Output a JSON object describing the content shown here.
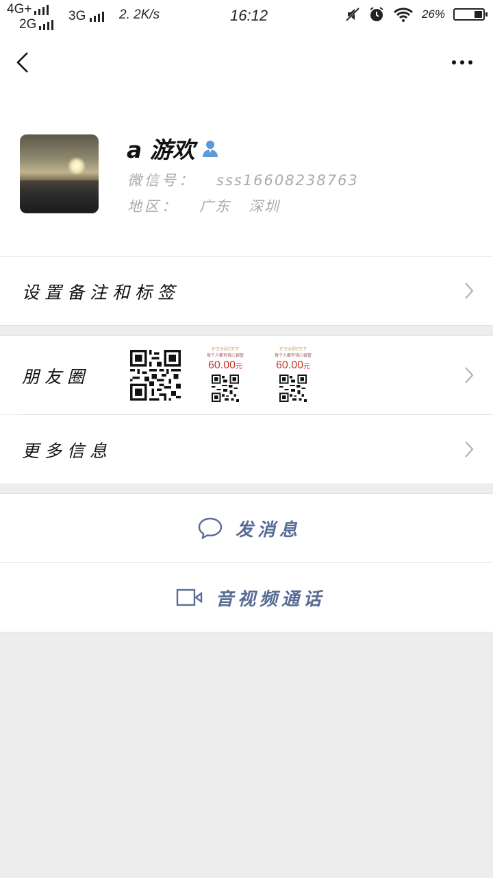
{
  "status_bar": {
    "net1": "4G+",
    "net2": "2G",
    "net3": "3G",
    "speed": "2. 2K/s",
    "time": "16:12",
    "battery": "26%",
    "battery_level": 0.26
  },
  "profile": {
    "nickname": "a 游欢",
    "wechat_id_label": "微信号：",
    "wechat_id": "sss16608238763",
    "region_label": "地区：",
    "region": "广东   深圳"
  },
  "cells": {
    "remark_label": "设置备注和标签",
    "moments_label": "朋友圈",
    "more_info_label": "更多信息"
  },
  "moments_promos": [
    {
      "price": "60.00",
      "unit": "元",
      "head": "护卫全程Z灭下",
      "sub": "每个人都有钱心银管"
    },
    {
      "price": "60.00",
      "unit": "元",
      "head": "护卫全程Z灭下",
      "sub": "每个人都有钱心银管"
    }
  ],
  "actions": {
    "message_label": "发消息",
    "video_call_label": "音视频通话"
  },
  "colors": {
    "link": "#576b95",
    "background": "#ededed"
  }
}
